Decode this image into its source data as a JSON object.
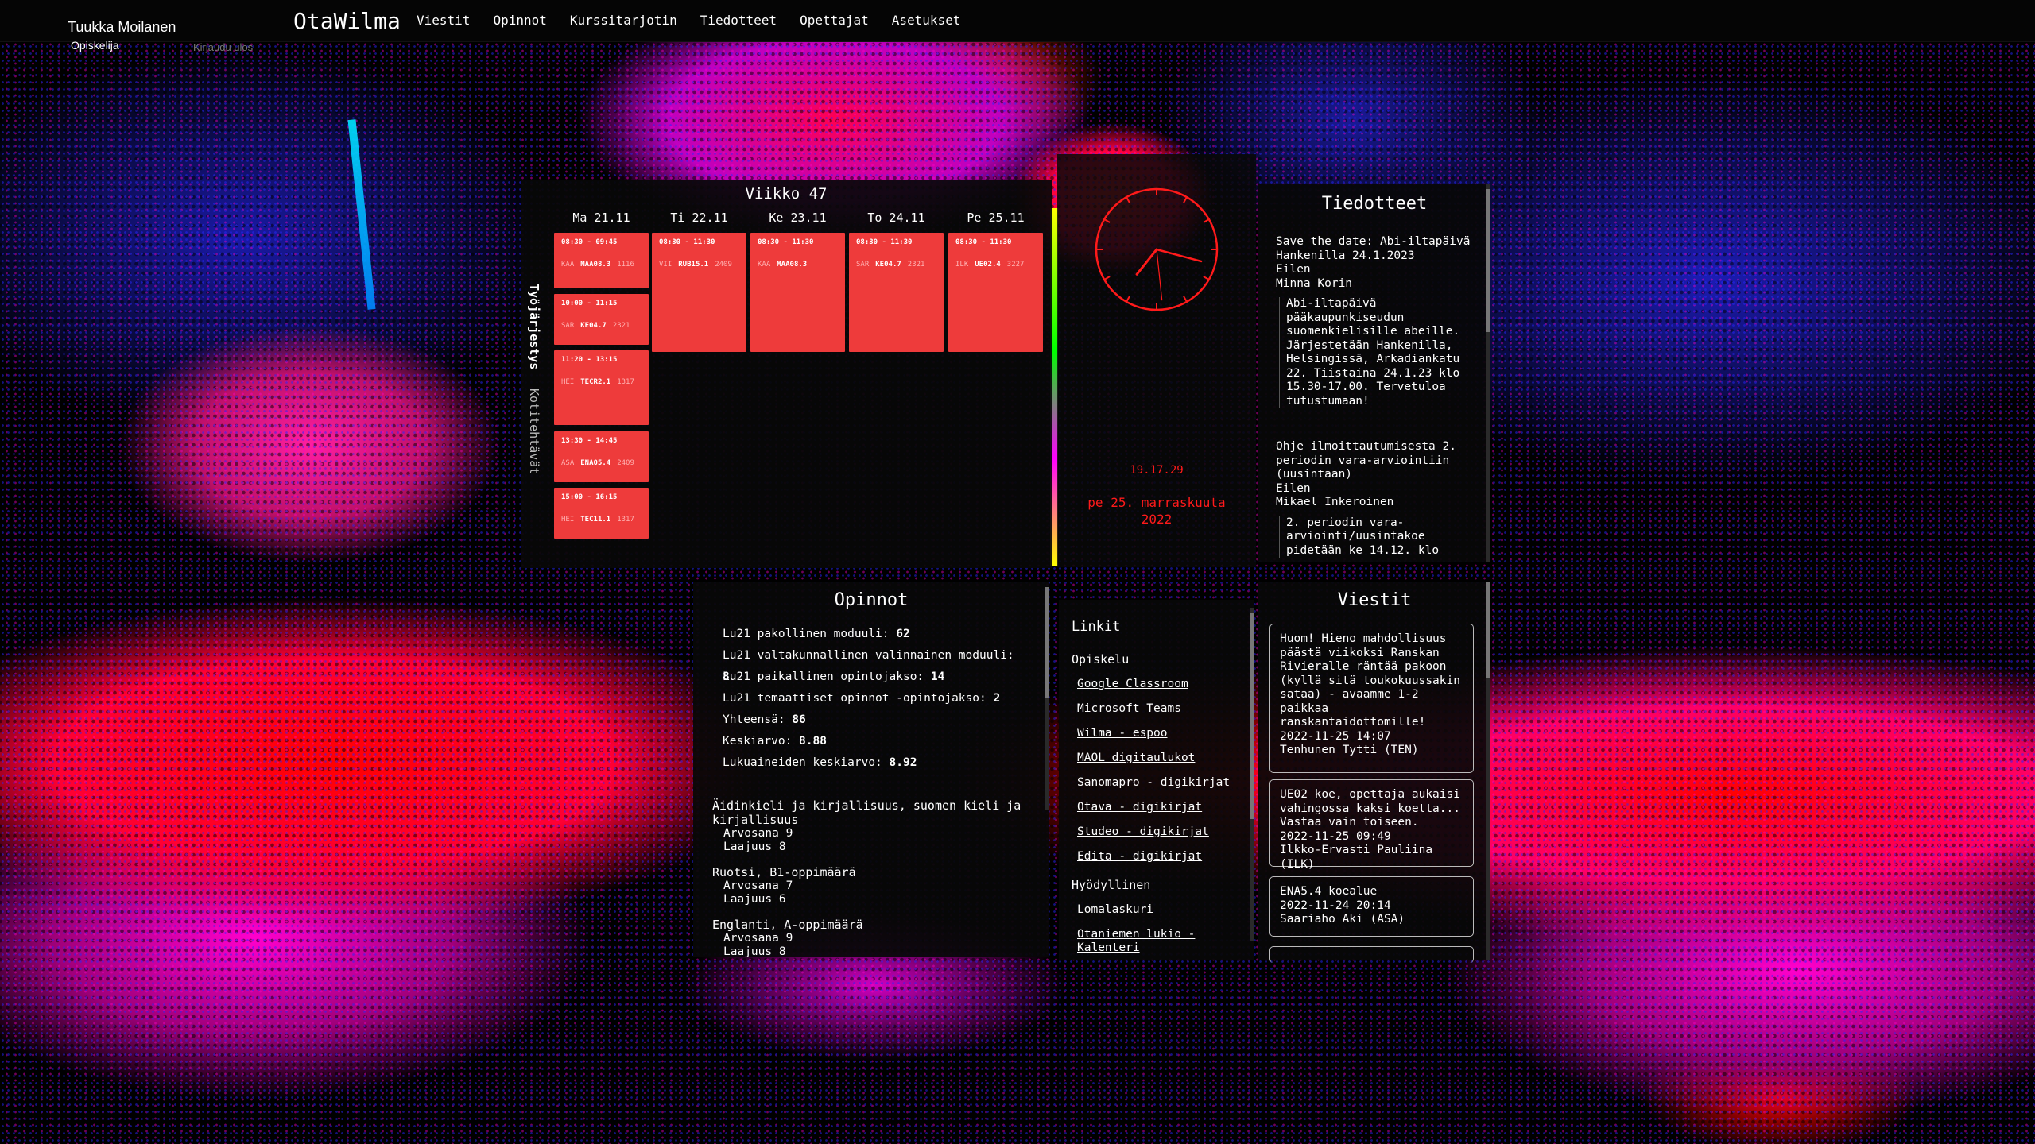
{
  "header": {
    "user_name": "Tuukka Moilanen",
    "user_role": "Opiskelija",
    "logout_label": "Kirjaudu ulos",
    "app_title": "OtaWilma",
    "nav": [
      "Viestit",
      "Opinnot",
      "Kurssitarjotin",
      "Tiedotteet",
      "Opettajat",
      "Asetukset"
    ]
  },
  "schedule": {
    "title": "Viikko 47",
    "tabs": [
      "Työjärjestys",
      "Kotitehtävät"
    ],
    "days": [
      "Ma 21.11",
      "Ti 22.11",
      "Ke 23.11",
      "To 24.11",
      "Pe 25.11"
    ],
    "lessons": [
      [
        {
          "time": "08:30 - 09:45",
          "teacher": "KAA",
          "course": "MAA08.3",
          "room": "1116"
        },
        {
          "time": "10:00 - 11:15",
          "teacher": "SAR",
          "course": "KE04.7",
          "room": "2321"
        },
        {
          "time": "11:20 - 13:15",
          "teacher": "HEI",
          "course": "TECR2.1",
          "room": "1317"
        },
        {
          "time": "13:30 - 14:45",
          "teacher": "ASA",
          "course": "ENA05.4",
          "room": "2409"
        },
        {
          "time": "15:00 - 16:15",
          "teacher": "HEI",
          "course": "TEC11.1",
          "room": "1317"
        }
      ],
      [
        {
          "time": "08:30 - 11:30",
          "teacher": "VII",
          "course": "RUB15.1",
          "room": "2409"
        }
      ],
      [
        {
          "time": "08:30 - 11:30",
          "teacher": "KAA",
          "course": "MAA08.3",
          "room": ""
        }
      ],
      [
        {
          "time": "08:30 - 11:30",
          "teacher": "SAR",
          "course": "KE04.7",
          "room": "2321"
        }
      ],
      [
        {
          "time": "08:30 - 11:30",
          "teacher": "ILK",
          "course": "UE02.4",
          "room": "3227"
        }
      ]
    ]
  },
  "clock": {
    "time": "19.17.29",
    "date_line1": "pe 25. marraskuuta",
    "date_line2": "2022",
    "hour": 7,
    "minute": 17,
    "second": 29,
    "color": "#ff1a1a"
  },
  "announcements": {
    "title": "Tiedotteet",
    "items": [
      {
        "title": "Save the date: Abi-iltapäivä Hankenilla 24.1.2023",
        "sender": "Eilen",
        "author": "Minna Korin",
        "body": "Abi-iltapäivä pääkaupunkiseudun suomenkielisille abeille. Järjestetään Hankenilla, Helsingissä, Arkadiankatu 22. Tiistaina 24.1.23 klo 15.30-17.00. Tervetuloa tutustumaan!"
      },
      {
        "title": "Ohje ilmoittautumisesta 2. periodin vara-arviointiin (uusintaan)",
        "sender": "Eilen",
        "author": "Mikael Inkeroinen",
        "body": "2. periodin vara-arviointi/uusintakoe pidetään ke 14.12. klo"
      }
    ]
  },
  "studies": {
    "title": "Opinnot",
    "summary": [
      {
        "label": "Lu21 pakollinen moduuli:",
        "value": "62"
      },
      {
        "label": "Lu21 valtakunnallinen valinnainen moduuli:",
        "value": "8"
      },
      {
        "label": "Lu21 paikallinen opintojakso:",
        "value": "14"
      },
      {
        "label": "Lu21 temaattiset opinnot -opintojakso:",
        "value": "2"
      },
      {
        "label": "Yhteensä:",
        "value": "86"
      },
      {
        "label": "Keskiarvo:",
        "value": "8.88"
      },
      {
        "label": "Lukuaineiden keskiarvo:",
        "value": "8.92"
      }
    ],
    "courses": [
      {
        "name": "Äidinkieli ja kirjallisuus, suomen kieli ja kirjallisuus",
        "grade": "Arvosana 9",
        "scope": "Laajuus 8"
      },
      {
        "name": "Ruotsi, B1-oppimäärä",
        "grade": "Arvosana 7",
        "scope": "Laajuus 6"
      },
      {
        "name": "Englanti, A-oppimäärä",
        "grade": "Arvosana 9",
        "scope": "Laajuus 8"
      }
    ]
  },
  "links": {
    "title": "Linkit",
    "sections": [
      {
        "name": "Opiskelu",
        "items": [
          "Google Classroom",
          "Microsoft Teams",
          "Wilma - espoo",
          "MAOL digitaulukot",
          "Sanomapro - digikirjat",
          "Otava - digikirjat",
          "Studeo - digikirjat",
          "Edita - digikirjat"
        ]
      },
      {
        "name": "Hyödyllinen",
        "items": [
          "Lomalaskuri",
          "Otaniemen lukio - Kalenteri"
        ]
      }
    ]
  },
  "messages": {
    "title": "Viestit",
    "items": [
      {
        "body": "Huom! Hieno mahdollisuus päästä viikoksi Ranskan Rivieralle räntää pakoon (kyllä sitä toukokuussakin sataa) - avaamme 1-2 paikkaa ranskantaidottomille!",
        "date": "2022-11-25 14:07",
        "sender": "Tenhunen Tytti (TEN)"
      },
      {
        "body": "UE02 koe, opettaja aukaisi vahingossa kaksi koetta... Vastaa vain toiseen.",
        "date": "2022-11-25 09:49",
        "sender": "Ilkko-Ervasti Pauliina (ILK)"
      },
      {
        "body": "ENA5.4 koealue",
        "date": "2022-11-24 20:14",
        "sender": "Saariaho Aki (ASA)"
      }
    ]
  }
}
